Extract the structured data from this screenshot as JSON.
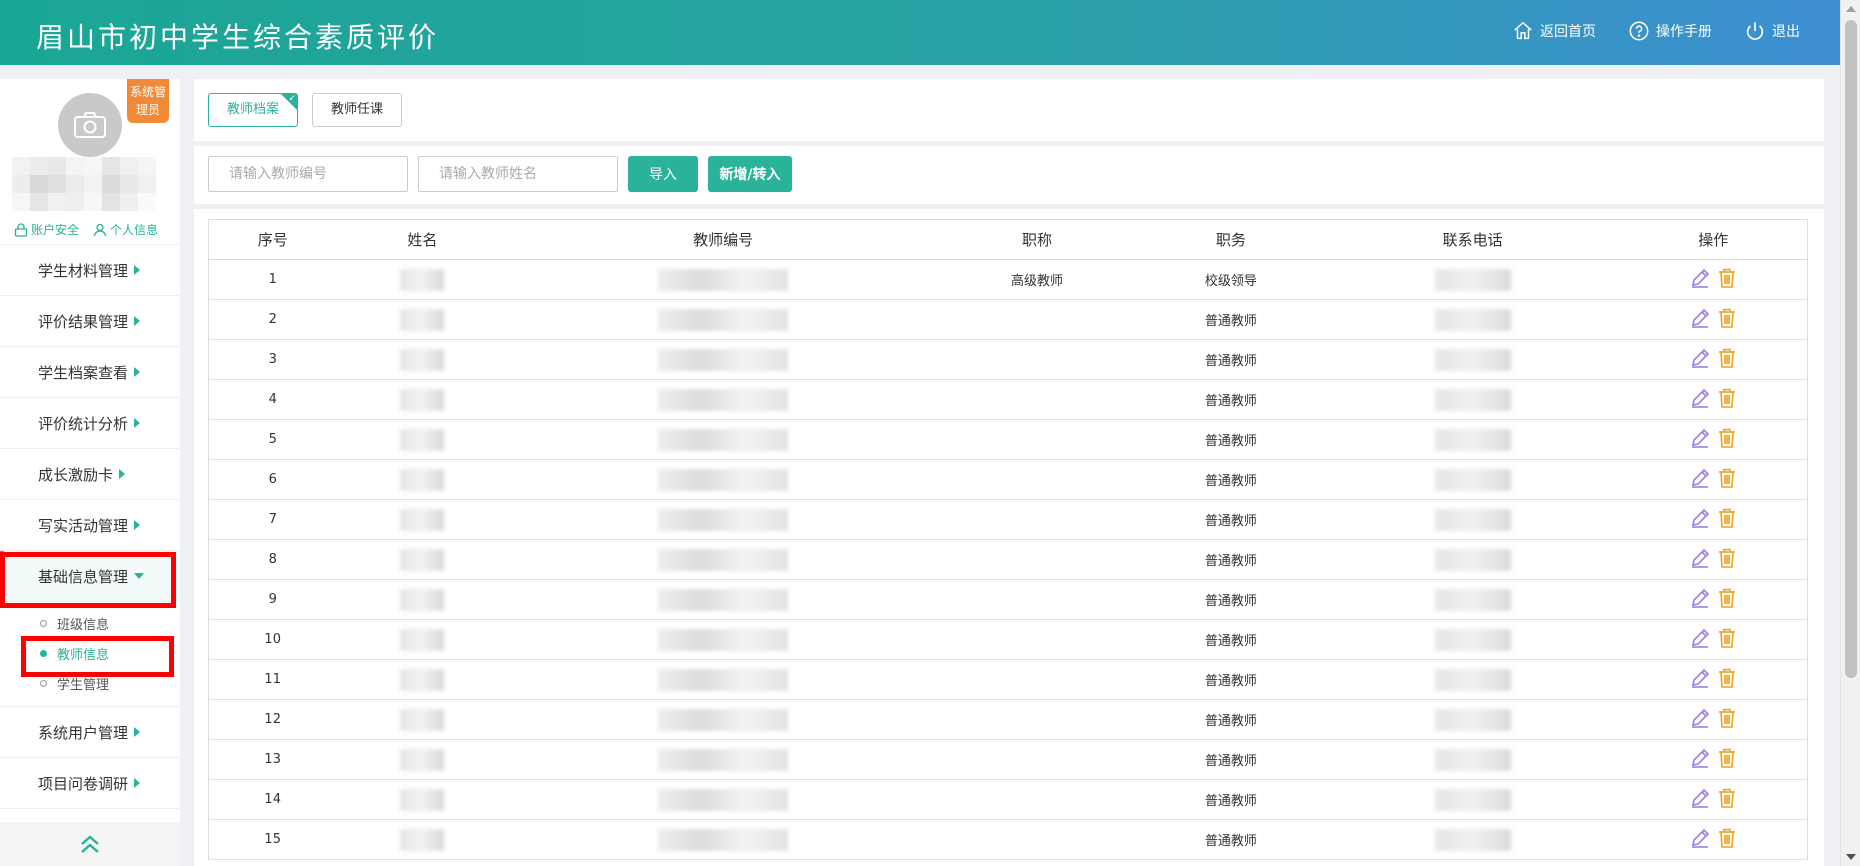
{
  "header": {
    "title": "眉山市初中学生综合素质评价",
    "links": [
      {
        "label": "返回首页",
        "icon": "home-icon"
      },
      {
        "label": "操作手册",
        "icon": "help-icon"
      },
      {
        "label": "退出",
        "icon": "power-icon"
      }
    ]
  },
  "profile": {
    "role_badge": "系统管理员",
    "account_security": "账户安全",
    "personal_info": "个人信息"
  },
  "sidebar": {
    "menu": [
      "学生材料管理",
      "评价结果管理",
      "学生档案查看",
      "评价统计分析",
      "成长激励卡",
      "写实活动管理",
      "基础信息管理"
    ],
    "submenu": [
      "班级信息",
      "教师信息",
      "学生管理"
    ],
    "menu_after": [
      "系统用户管理",
      "项目问卷调研"
    ]
  },
  "tabs": [
    "教师档案",
    "教师任课"
  ],
  "toolbar": {
    "teacher_no_placeholder": "请输入教师编号",
    "teacher_name_placeholder": "请输入教师姓名",
    "import_label": "导入",
    "add_transfer_label": "新增/转入"
  },
  "table": {
    "columns": [
      "序号",
      "姓名",
      "教师编号",
      "职称",
      "职务",
      "联系电话",
      "操作"
    ],
    "rows": [
      {
        "no": "1",
        "title": "高级教师",
        "duty": "校级领导"
      },
      {
        "no": "2",
        "title": "",
        "duty": "普通教师"
      },
      {
        "no": "3",
        "title": "",
        "duty": "普通教师"
      },
      {
        "no": "4",
        "title": "",
        "duty": "普通教师"
      },
      {
        "no": "5",
        "title": "",
        "duty": "普通教师"
      },
      {
        "no": "6",
        "title": "",
        "duty": "普通教师"
      },
      {
        "no": "7",
        "title": "",
        "duty": "普通教师"
      },
      {
        "no": "8",
        "title": "",
        "duty": "普通教师"
      },
      {
        "no": "9",
        "title": "",
        "duty": "普通教师"
      },
      {
        "no": "10",
        "title": "",
        "duty": "普通教师"
      },
      {
        "no": "11",
        "title": "",
        "duty": "普通教师"
      },
      {
        "no": "12",
        "title": "",
        "duty": "普通教师"
      },
      {
        "no": "13",
        "title": "",
        "duty": "普通教师"
      },
      {
        "no": "14",
        "title": "",
        "duty": "普通教师"
      },
      {
        "no": "15",
        "title": "",
        "duty": "普通教师"
      }
    ]
  },
  "colors": {
    "accent": "#2bb29a",
    "badge": "#f08a36",
    "edit": "#9b7fe0",
    "delete": "#f0a020",
    "highlight": "#ff0000"
  }
}
